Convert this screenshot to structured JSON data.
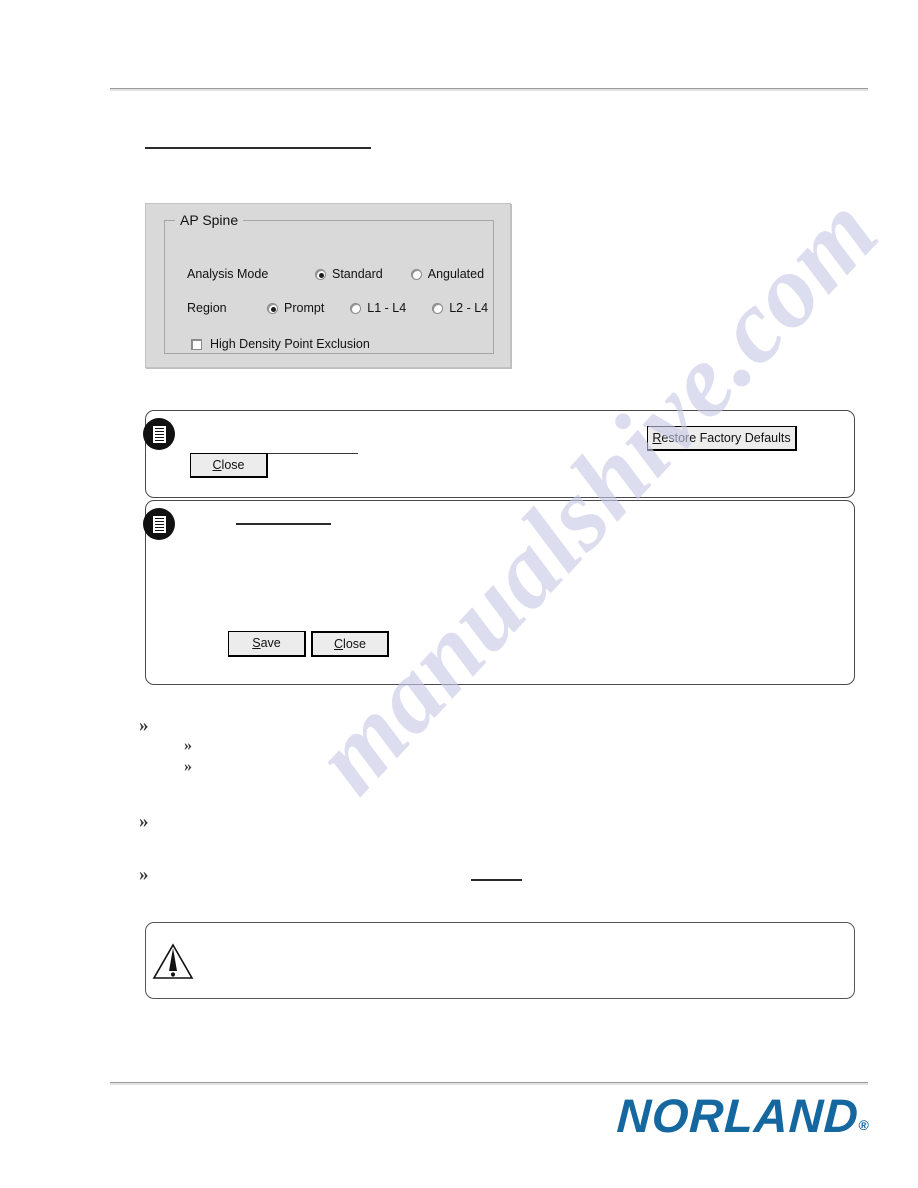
{
  "document": {
    "watermark": "manualshive.com",
    "brand": "NORLAND",
    "brand_mark": "®"
  },
  "dialog": {
    "group_title": "AP Spine",
    "fields": [
      {
        "label": "Analysis Mode",
        "type": "radio-group",
        "options": [
          {
            "label": "Standard",
            "selected": true
          },
          {
            "label": "Angulated",
            "selected": false
          }
        ]
      },
      {
        "label": "Region",
        "type": "radio-group",
        "options": [
          {
            "label": "Prompt",
            "selected": true
          },
          {
            "label": "L1 - L4",
            "selected": false
          },
          {
            "label": "L2 - L4",
            "selected": false
          }
        ]
      },
      {
        "label": "High Density Point Exclusion",
        "type": "checkbox",
        "checked": false
      }
    ]
  },
  "notes": [
    {
      "icon": "note-icon",
      "buttons": [
        {
          "label": "Close",
          "accel": "C",
          "default": false
        },
        {
          "label": "Restore Factory Defaults",
          "accel": "R",
          "default": false
        }
      ]
    },
    {
      "icon": "note-icon",
      "buttons": [
        {
          "label": "Save",
          "accel": "S",
          "default": false
        },
        {
          "label": "Close",
          "accel": "C",
          "default": true
        }
      ]
    }
  ],
  "warning": {
    "icon": "warning-triangle-icon",
    "text": ""
  },
  "bullets": [
    {
      "marker": "»",
      "level": 1,
      "text": ""
    },
    {
      "marker": "»",
      "level": 2,
      "text": ""
    },
    {
      "marker": "»",
      "level": 2,
      "text": ""
    },
    {
      "marker": "»",
      "level": 1,
      "text": ""
    },
    {
      "marker": "»",
      "level": 1,
      "text": ""
    }
  ],
  "button_labels": {
    "close_1_pre": "C",
    "close_1_post": "lose",
    "restore_pre": "R",
    "restore_post": "estore Factory Defaults",
    "save_pre": "S",
    "save_post": "ave",
    "close_2_pre": "C",
    "close_2_post": "lose"
  }
}
